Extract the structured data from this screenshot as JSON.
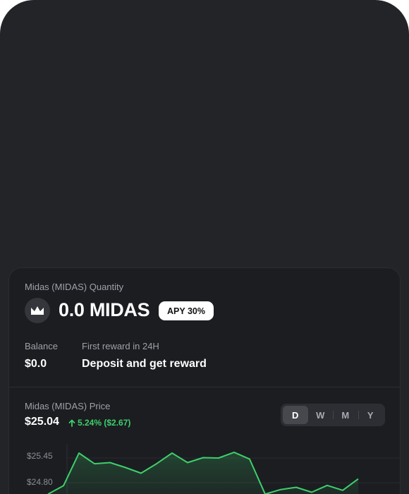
{
  "staking": {
    "quantity_label": "Midas (MIDAS) Quantity",
    "quantity_value": "0.0 MIDAS",
    "token_icon": "midas-crown-icon",
    "apy_badge": "APY 30%",
    "balance_label": "Balance",
    "balance_value": "$0.0",
    "reward_label": "First reward in 24H",
    "reward_value": "Deposit and get reward"
  },
  "price": {
    "label": "Midas (MIDAS) Price",
    "value": "$25.04",
    "change": "5.24% ($2.67)",
    "change_icon": "arrow-up-icon",
    "periods": [
      "D",
      "W",
      "M",
      "Y"
    ],
    "active_period": "D"
  },
  "colors": {
    "background": "#222428",
    "card": "#1b1d21",
    "positive": "#3ecf6b",
    "badge": "#ffffff"
  },
  "chart_data": {
    "type": "line",
    "y_ticks": [
      "$25.45",
      "$24.80"
    ],
    "ylim": [
      24.2,
      25.8
    ],
    "x": [
      1,
      2,
      3,
      4,
      5,
      6,
      7,
      8,
      9,
      10,
      11,
      12,
      13,
      14,
      15,
      16,
      17,
      18,
      19,
      20,
      21
    ],
    "values": [
      24.5,
      24.72,
      25.58,
      25.3,
      25.33,
      25.2,
      25.05,
      25.3,
      25.58,
      25.33,
      25.46,
      25.45,
      25.6,
      25.42,
      24.5,
      24.62,
      24.68,
      24.55,
      24.73,
      24.6,
      24.9
    ]
  }
}
